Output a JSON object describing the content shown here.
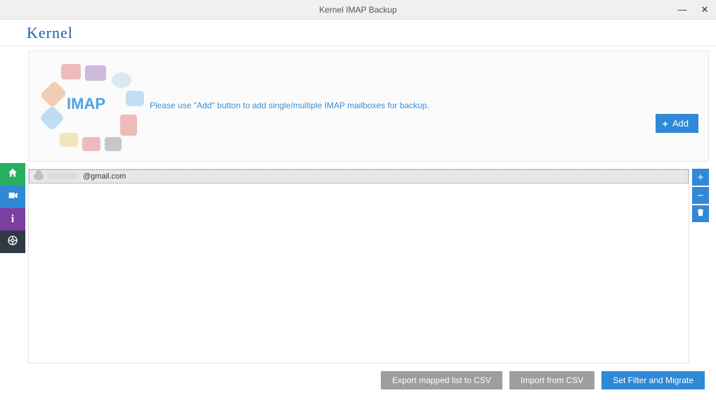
{
  "window": {
    "title": "Kernel IMAP Backup"
  },
  "brand": {
    "logo": "Kernel"
  },
  "sidebar": {
    "items": [
      {
        "name": "home-icon"
      },
      {
        "name": "video-icon"
      },
      {
        "name": "info-icon"
      },
      {
        "name": "help-icon"
      }
    ]
  },
  "info": {
    "graphic_label": "IMAP",
    "instruction": "Please use \"Add\" button to add single/multiple IMAP mailboxes for backup.",
    "add_label": "Add"
  },
  "mailboxes": [
    {
      "display": "@gmail.com"
    }
  ],
  "tools": {
    "add": "+",
    "remove": "−"
  },
  "footer": {
    "export_label": "Export mapped list to CSV",
    "import_label": "Import from CSV",
    "migrate_label": "Set Filter and Migrate"
  }
}
